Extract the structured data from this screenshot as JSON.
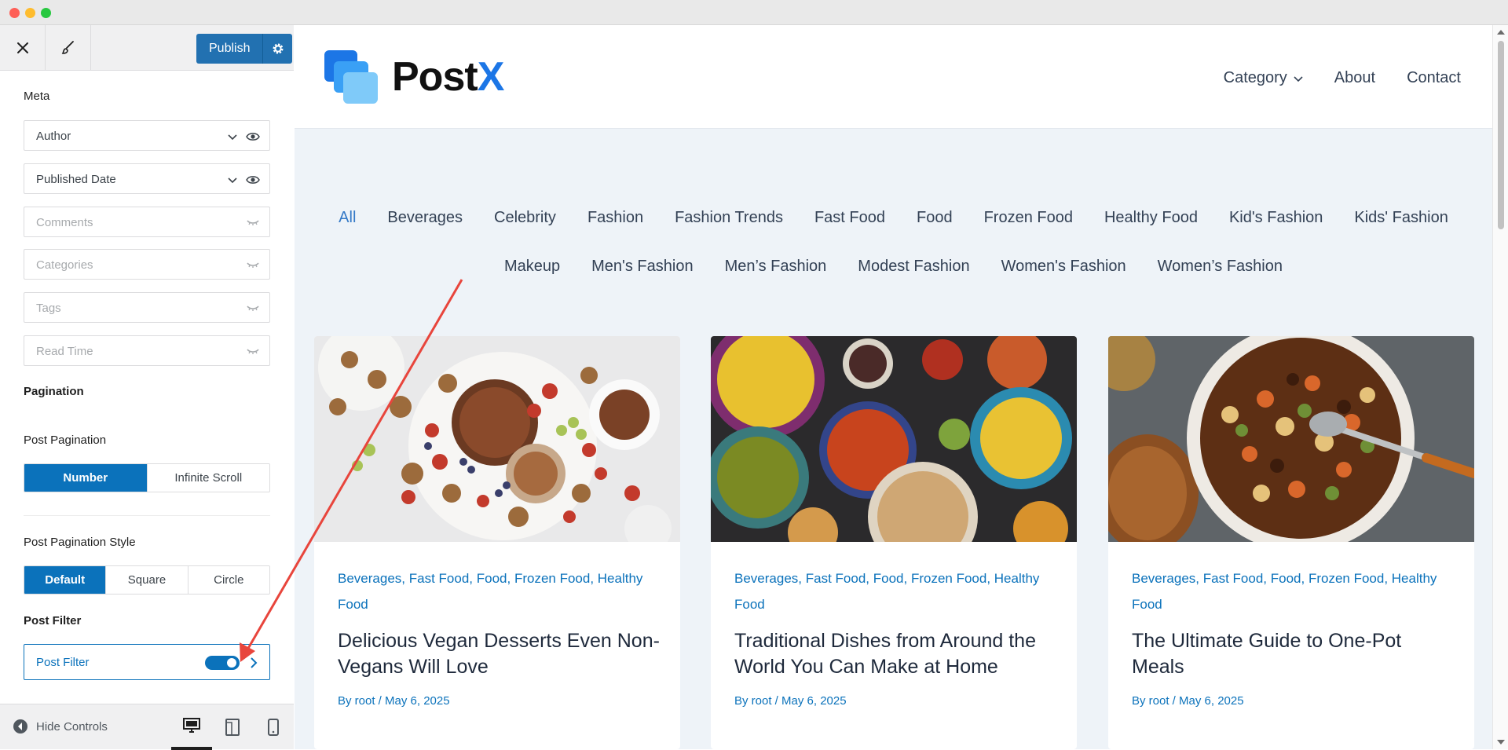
{
  "sidebar": {
    "publish_label": "Publish",
    "meta_title": "Meta",
    "meta_items": [
      {
        "label": "Author",
        "enabled": true
      },
      {
        "label": "Published Date",
        "enabled": true
      },
      {
        "label": "Comments",
        "enabled": false
      },
      {
        "label": "Categories",
        "enabled": false
      },
      {
        "label": "Tags",
        "enabled": false
      },
      {
        "label": "Read Time",
        "enabled": false
      }
    ],
    "pagination_title": "Pagination",
    "post_pagination_label": "Post Pagination",
    "post_pagination_options": [
      "Number",
      "Infinite Scroll"
    ],
    "post_pagination_style_label": "Post Pagination Style",
    "post_pagination_style_options": [
      "Default",
      "Square",
      "Circle"
    ],
    "post_filter_title": "Post Filter",
    "post_filter_row_label": "Post Filter",
    "post_filter_enabled": true,
    "hide_controls_label": "Hide Controls"
  },
  "site": {
    "logo_text_main": "Post",
    "logo_text_accent": "X",
    "nav": [
      "Category",
      "About",
      "Contact"
    ]
  },
  "filters_row1": [
    "All",
    "Beverages",
    "Celebrity",
    "Fashion",
    "Fashion Trends",
    "Fast Food",
    "Food",
    "Frozen Food",
    "Healthy Food",
    "Kid's Fashion",
    "Kids' Fashion"
  ],
  "filters_row2": [
    "Makeup",
    "Men's Fashion",
    "Men’s Fashion",
    "Modest Fashion",
    "Women's Fashion",
    "Women’s Fashion"
  ],
  "posts": [
    {
      "categories_line1": [
        "Beverages",
        "Fast Food",
        "Food",
        "Frozen Food",
        "Healthy"
      ],
      "categories_line2": "Food",
      "title": "Delicious Vegan Desserts Even Non-Vegans Will Love",
      "byline": "By root / May 6, 2025"
    },
    {
      "categories_line1": [
        "Beverages",
        "Fast Food",
        "Food",
        "Frozen Food",
        "Healthy"
      ],
      "categories_line2": "Food",
      "title": "Traditional Dishes from Around the World You Can Make at Home",
      "byline": "By root / May 6, 2025"
    },
    {
      "categories_line1": [
        "Beverages",
        "Fast Food",
        "Food",
        "Frozen Food",
        "Healthy"
      ],
      "categories_line2": "Food",
      "title": "The Ultimate Guide to One-Pot Meals",
      "byline": "By root / May 6, 2025"
    }
  ],
  "colors": {
    "accent": "#0b72bb",
    "annotation_arrow": "#e8453c"
  }
}
